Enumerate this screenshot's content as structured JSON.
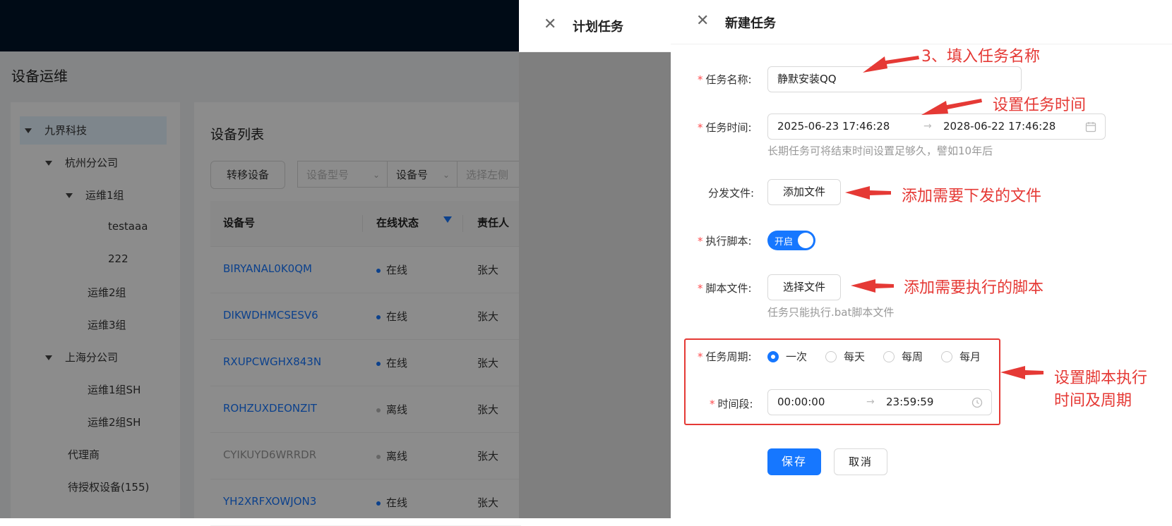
{
  "app": {
    "page_title": "设备运维",
    "tree": [
      {
        "label": "九界科技",
        "expanded": true,
        "selected": true
      },
      {
        "label": "杭州分公司",
        "expanded": true
      },
      {
        "label": "运维1组",
        "expanded": true
      },
      {
        "label": "testaaa"
      },
      {
        "label": "222"
      },
      {
        "label": "运维2组"
      },
      {
        "label": "运维3组"
      },
      {
        "label": "上海分公司",
        "expanded": true
      },
      {
        "label": "运维1组SH"
      },
      {
        "label": "运维2组SH"
      },
      {
        "label": "代理商"
      },
      {
        "label": "待授权设备(155)"
      }
    ],
    "device_list": {
      "title": "设备列表",
      "transfer_button": "转移设备",
      "filters": {
        "model_placeholder": "设备型号",
        "device_no": "设备号",
        "left_placeholder": "选择左侧"
      },
      "columns": [
        "设备号",
        "在线状态",
        "责任人"
      ],
      "rows": [
        {
          "id": "BIRYANAL0K0QM",
          "status": "在线",
          "owner": "张大"
        },
        {
          "id": "DIKWDHMCSESV6",
          "status": "在线",
          "owner": "张大"
        },
        {
          "id": "RXUPCWGHX843N",
          "status": "在线",
          "owner": "张大"
        },
        {
          "id": "ROHZUXDEONZIT",
          "status": "离线",
          "owner": "张大"
        },
        {
          "id": "CYIKUYD6WRRDR",
          "status": "离线",
          "owner": "张大"
        },
        {
          "id": "YH2XRFXOWJON3",
          "status": "在线",
          "owner": "张大"
        }
      ]
    }
  },
  "drawer_plan": {
    "title": "计划任务"
  },
  "drawer_new": {
    "title": "新建任务",
    "task_name": {
      "label": "任务名称:",
      "value": "静默安装QQ"
    },
    "task_time": {
      "label": "任务时间:",
      "start": "2025-06-23 17:46:28",
      "end": "2028-06-22 17:46:28",
      "hint": "长期任务可将结束时间设置足够久，譬如10年后"
    },
    "dist_files": {
      "label": "分发文件:",
      "button": "添加文件"
    },
    "exec_script": {
      "label": "执行脚本:",
      "switch_text": "开启",
      "on": true
    },
    "script_file": {
      "label": "脚本文件:",
      "button": "选择文件",
      "hint": "任务只能执行.bat脚本文件"
    },
    "period": {
      "label": "任务周期:",
      "options": [
        "一次",
        "每天",
        "每周",
        "每月"
      ],
      "selected": "一次"
    },
    "time_range": {
      "label": "时间段:",
      "start": "00:00:00",
      "end": "23:59:59"
    },
    "save_button": "保存",
    "cancel_button": "取消"
  },
  "annotations": {
    "name": "3、填入任务名称",
    "time": "设置任务时间",
    "files": "添加需要下发的文件",
    "script": "添加需要执行的脚本",
    "period_line1": "设置脚本执行",
    "period_line2": "时间及周期"
  },
  "colors": {
    "primary": "#1677ff",
    "annotation_red": "#e53935",
    "topbar": "#001529"
  }
}
